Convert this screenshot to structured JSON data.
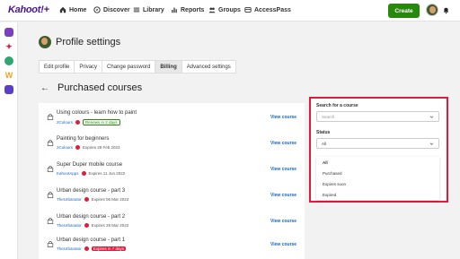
{
  "brand": {
    "logo_text": "Kahoot!+"
  },
  "nav": {
    "items": [
      {
        "label": "Home",
        "icon": "home-icon"
      },
      {
        "label": "Discover",
        "icon": "compass-icon"
      },
      {
        "label": "Library",
        "icon": "library-icon"
      },
      {
        "label": "Reports",
        "icon": "reports-icon"
      },
      {
        "label": "Groups",
        "icon": "groups-icon"
      },
      {
        "label": "AccessPass",
        "icon": "accesspass-icon"
      }
    ],
    "create_label": "Create"
  },
  "profile": {
    "title": "Profile settings",
    "tabs": [
      {
        "label": "Edit profile",
        "active": false
      },
      {
        "label": "Privacy",
        "active": false
      },
      {
        "label": "Change password",
        "active": false
      },
      {
        "label": "Billing",
        "active": true
      },
      {
        "label": "Advanced settings",
        "active": false
      }
    ]
  },
  "purchased": {
    "title": "Purchased courses",
    "back_glyph": "←",
    "view_label": "View course",
    "courses": [
      {
        "name": "Using colours - learn how to paint",
        "author": "2Colours",
        "status": "Renews in 2 days",
        "status_style": "green"
      },
      {
        "name": "Painting for beginners",
        "author": "2Colours",
        "status": "Expires 28 Feb 2023",
        "status_style": "plain"
      },
      {
        "name": "Super Duper mobile course",
        "author": "KahootApps",
        "status": "Expires 11 Jun 2022",
        "status_style": "plain"
      },
      {
        "name": "Urban design course - part 3",
        "author": "TheUrbanator",
        "status": "Expires 06 Mar 2022",
        "status_style": "plain"
      },
      {
        "name": "Urban design course - part 2",
        "author": "TheUrbanator",
        "status": "Expires 28 Mar 2022",
        "status_style": "plain"
      },
      {
        "name": "Urban design course - part 1",
        "author": "TheUrbanator",
        "status": "Expires in 7 days",
        "status_style": "red"
      }
    ]
  },
  "filters": {
    "search_label": "Search for a course",
    "search_placeholder": "Search",
    "status_label": "Status",
    "status_value": "All",
    "status_options": [
      "All",
      "Purchased",
      "Expires soon",
      "Expired"
    ]
  },
  "colors": {
    "accent_purple": "#46178f",
    "create_green": "#26890c",
    "highlight_red": "#e21b3c",
    "link_blue": "#1368ce"
  }
}
